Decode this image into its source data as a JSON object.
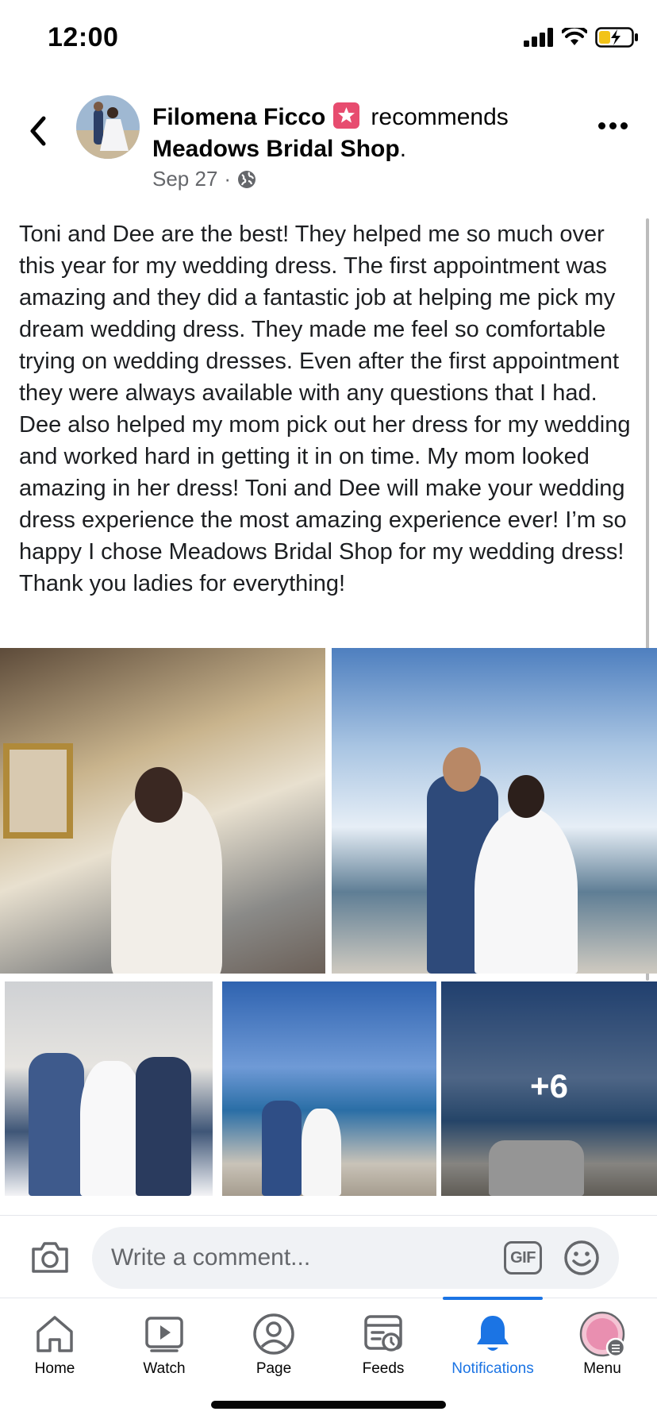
{
  "status_bar": {
    "time": "12:00"
  },
  "post": {
    "author": "Filomena Ficco",
    "action": "recommends",
    "page_name": "Meadows Bridal Shop",
    "page_suffix": ".",
    "date": "Sep 27",
    "separator": "·",
    "body": "Toni and Dee are the best! They helped me so much over this year for my wedding dress. The first appointment was amazing and they did a fantastic job at helping me pick my dream wedding dress. They made me feel so comfortable trying on wedding dresses. Even after the first appointment they were always available with any questions that I had. Dee also helped my mom pick out her dress for my wedding and worked hard in getting it in on time. My mom looked amazing in her dress! Toni and Dee will make your wedding dress experience the most amazing experience ever! I’m so happy I chose Meadows Bridal Shop for my wedding dress! Thank you ladies for everything!",
    "more_photos": "+6"
  },
  "comment": {
    "placeholder": "Write a comment...",
    "gif_label": "GIF"
  },
  "tabs": [
    {
      "label": "Home"
    },
    {
      "label": "Watch"
    },
    {
      "label": "Page"
    },
    {
      "label": "Feeds"
    },
    {
      "label": "Notifications"
    },
    {
      "label": "Menu"
    }
  ],
  "colors": {
    "accent": "#1b74e4",
    "secondary_text": "#65676b",
    "badge": "#e74c6f"
  }
}
